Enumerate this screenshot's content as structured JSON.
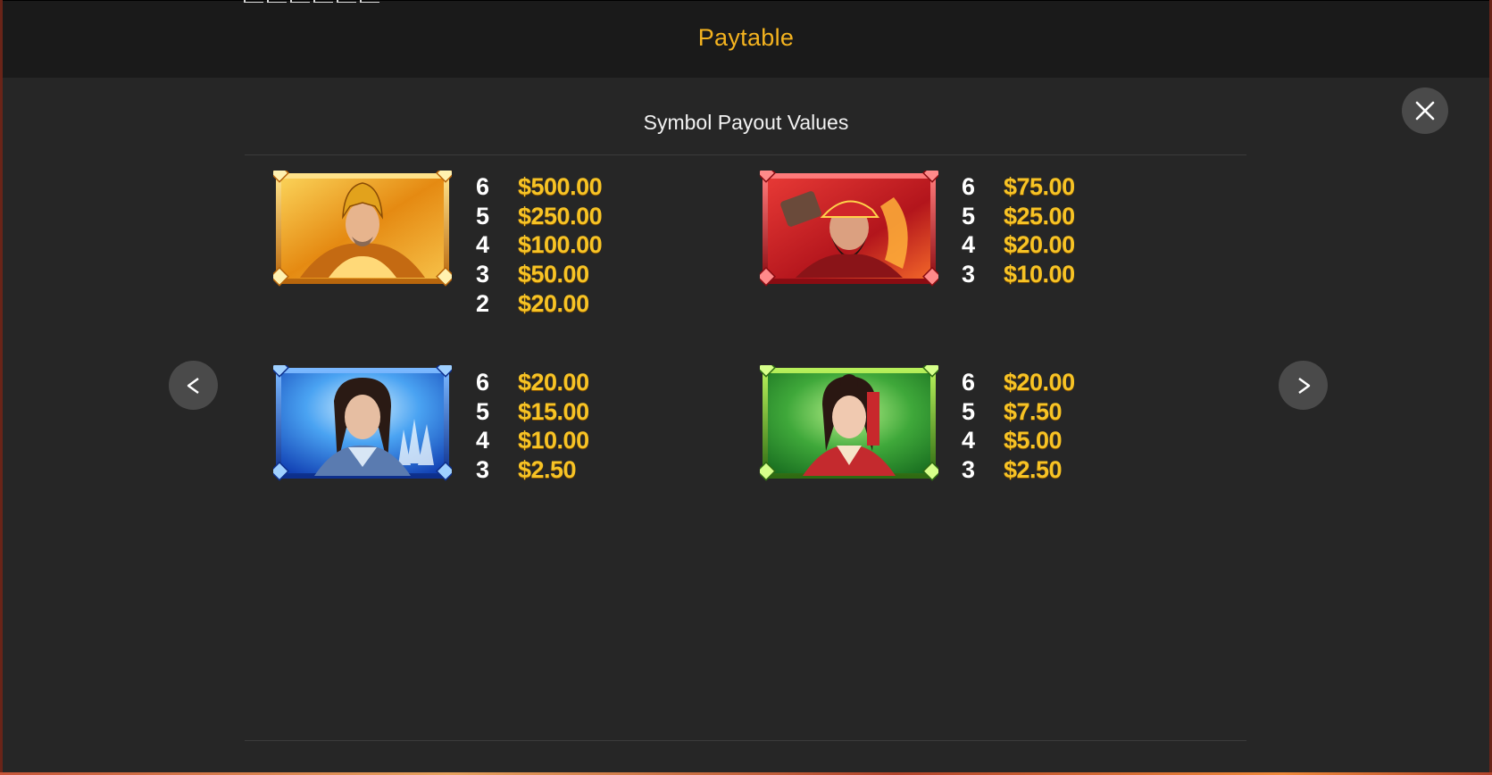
{
  "header": {
    "title": "Paytable"
  },
  "subtitle": "Symbol Payout Values",
  "nav": {
    "prev_label": "<",
    "next_label": ">"
  },
  "close_icon": "close-icon",
  "colors": {
    "title": "#f4b31f",
    "payout_value": "#f7c325",
    "count": "#ffffff",
    "background": "#262626",
    "header_bg": "#1a1a1a",
    "button_bg": "#4a4a4a"
  },
  "symbols": [
    {
      "name": "gold-warrior-symbol",
      "frame_color": "gold",
      "payouts": [
        {
          "count": "6",
          "value": "$500.00"
        },
        {
          "count": "5",
          "value": "$250.00"
        },
        {
          "count": "4",
          "value": "$100.00"
        },
        {
          "count": "3",
          "value": "$50.00"
        },
        {
          "count": "2",
          "value": "$20.00"
        }
      ]
    },
    {
      "name": "red-warrior-symbol",
      "frame_color": "red",
      "payouts": [
        {
          "count": "6",
          "value": "$75.00"
        },
        {
          "count": "5",
          "value": "$25.00"
        },
        {
          "count": "4",
          "value": "$20.00"
        },
        {
          "count": "3",
          "value": "$10.00"
        }
      ]
    },
    {
      "name": "blue-strategist-symbol",
      "frame_color": "blue",
      "payouts": [
        {
          "count": "6",
          "value": "$20.00"
        },
        {
          "count": "5",
          "value": "$15.00"
        },
        {
          "count": "4",
          "value": "$10.00"
        },
        {
          "count": "3",
          "value": "$2.50"
        }
      ]
    },
    {
      "name": "green-lady-symbol",
      "frame_color": "green",
      "payouts": [
        {
          "count": "6",
          "value": "$20.00"
        },
        {
          "count": "5",
          "value": "$7.50"
        },
        {
          "count": "4",
          "value": "$5.00"
        },
        {
          "count": "3",
          "value": "$2.50"
        }
      ]
    }
  ]
}
